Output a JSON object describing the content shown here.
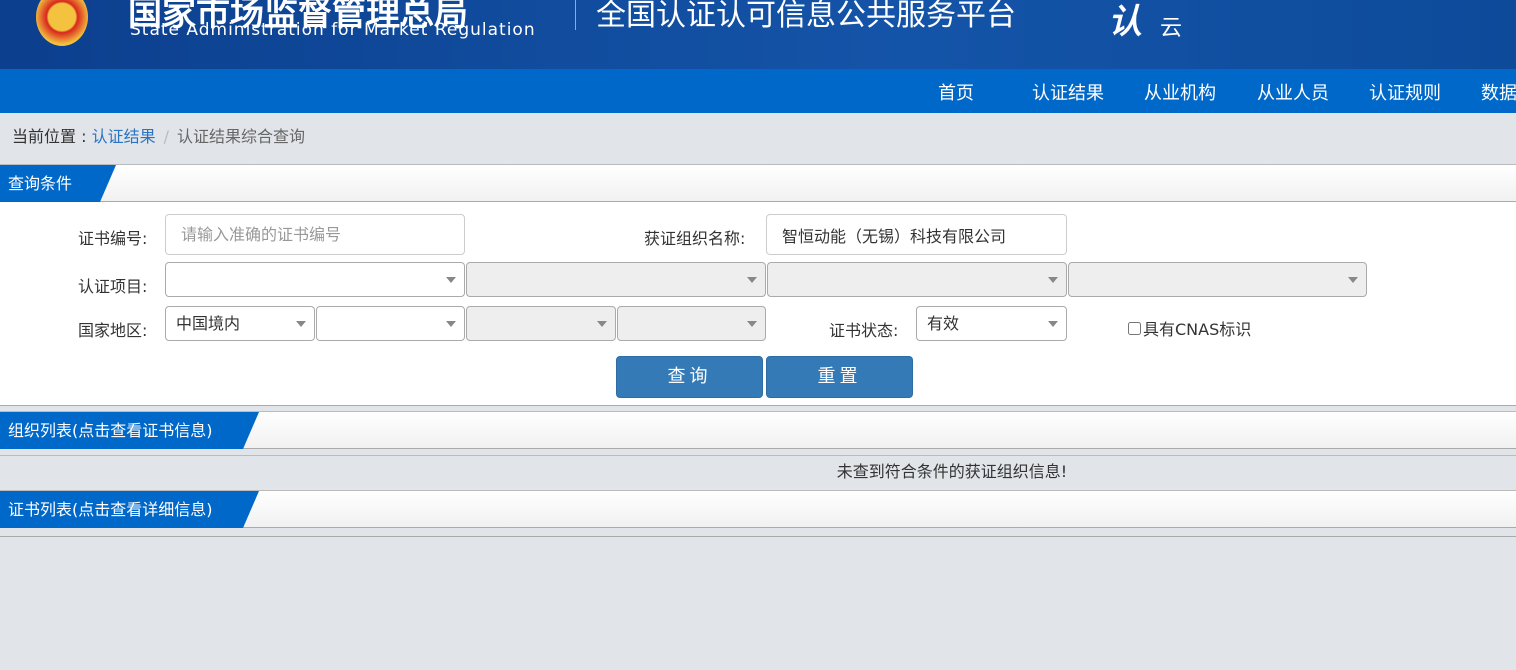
{
  "header": {
    "agency_cn": "国家市场监督管理总局",
    "agency_en": "State Administration  for  Market Regulation",
    "platform": "全国认证认可信息公共服务平台",
    "logo_text": "认",
    "logo_sub": "云"
  },
  "nav": [
    "首页",
    "认证结果",
    "从业机构",
    "从业人员",
    "认证规则",
    "数据"
  ],
  "breadcrumb": {
    "prefix": "当前位置 :",
    "link": "认证结果",
    "sep": "/",
    "current": "认证结果综合查询"
  },
  "query": {
    "title": "查询条件",
    "cert_no_label": "证书编号:",
    "cert_no_placeholder": "请输入准确的证书编号",
    "cert_no_value": "",
    "org_label": "获证组织名称:",
    "org_value": "智恒动能（无锡）科技有限公司",
    "project_label": "认证项目:",
    "region_label": "国家地区:",
    "region_value": "中国境内",
    "status_label": "证书状态:",
    "status_value": "有效",
    "cnas_label": "具有CNAS标识",
    "cnas_checked": false,
    "search_btn": "查询",
    "reset_btn": "重置"
  },
  "org_list": {
    "title": "组织列表(点击查看证书信息)",
    "empty_msg": "未查到符合条件的获证组织信息!"
  },
  "cert_list": {
    "title": "证书列表(点击查看详细信息)"
  },
  "colors": {
    "header": "#0c3f8e",
    "nav": "#0068c9",
    "button": "#337ab7"
  }
}
